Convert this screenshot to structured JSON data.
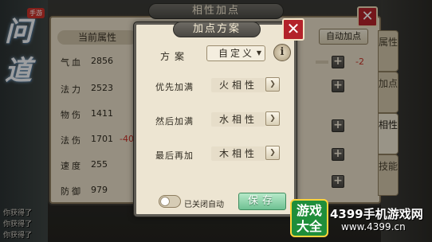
{
  "logo": {
    "title": "问道",
    "badge": "手游"
  },
  "panel": {
    "title": "相性加点",
    "current_attr_label": "当前属性",
    "auto_button": "自动加点",
    "stats": [
      {
        "label": "气血",
        "value": "2856",
        "extra": "",
        "delta": "-2"
      },
      {
        "label": "法力",
        "value": "2523",
        "extra": "",
        "delta": ""
      },
      {
        "label": "物伤",
        "value": "1411",
        "extra": "",
        "delta": ""
      },
      {
        "label": "法伤",
        "value": "1701",
        "extra": "-40",
        "delta": ""
      },
      {
        "label": "速度",
        "value": "255",
        "extra": "",
        "delta": ""
      },
      {
        "label": "防御",
        "value": "979",
        "extra": "",
        "delta": ""
      }
    ],
    "side_tabs": [
      "属性",
      "加点",
      "相性",
      "技能"
    ]
  },
  "chat": [
    "你获得了",
    "你获得了",
    "你获得了"
  ],
  "modal": {
    "title": "加点方案",
    "scheme_label": "方案",
    "scheme_value": "自定义",
    "scheme_arrow": "▼",
    "info_icon": "i",
    "rows": [
      {
        "label": "优先加满",
        "value": "火相性"
      },
      {
        "label": "然后加满",
        "value": "水相性"
      },
      {
        "label": "最后再加",
        "value": "木相性"
      }
    ],
    "arrow_glyph": "❯",
    "toggle_label": "已关闭自动",
    "save_button": "保存",
    "close_glyph": "✕"
  },
  "watermark": {
    "badge_line1": "游戏",
    "badge_line2": "大全",
    "text": "4399手机游戏网",
    "url": "www.4399.cn"
  }
}
